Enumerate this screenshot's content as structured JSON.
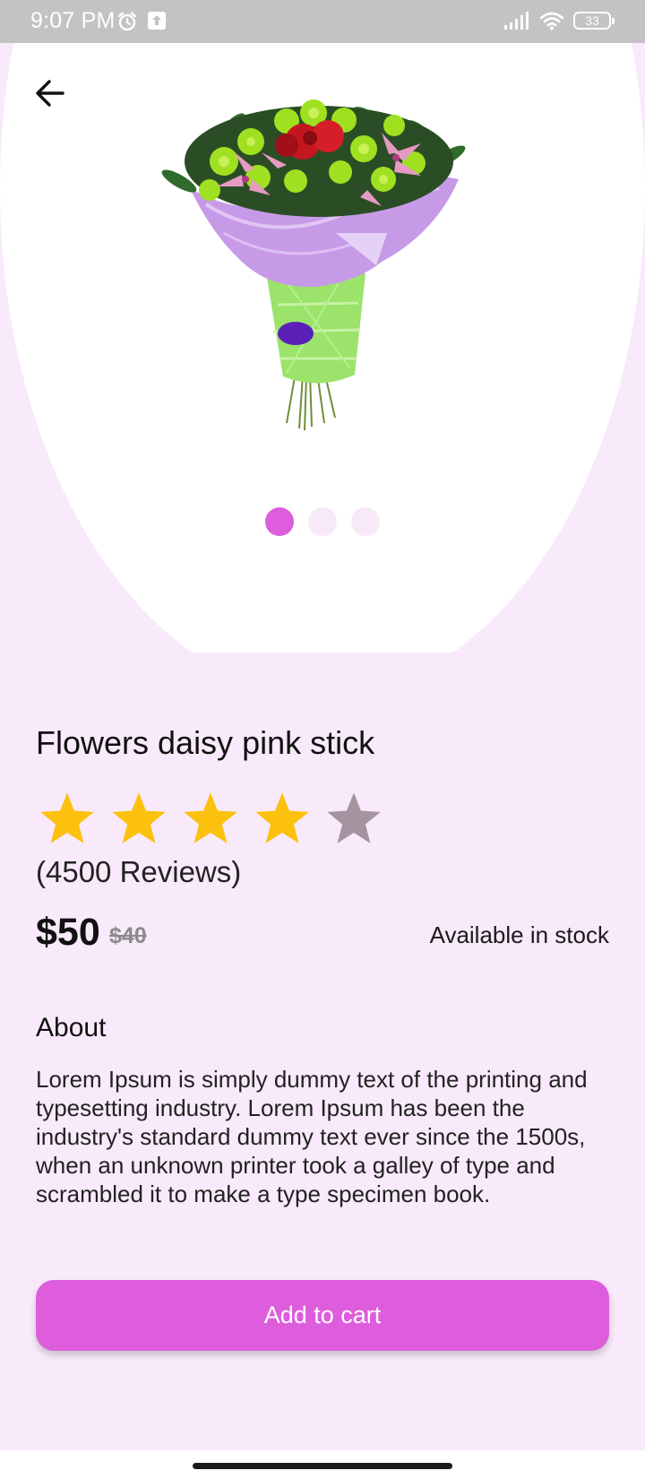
{
  "status_bar": {
    "time": "9:07 PM",
    "battery": "33",
    "icons": [
      "alarm-icon",
      "upload-icon",
      "signal-icon",
      "wifi-icon",
      "battery-icon"
    ]
  },
  "navigation": {
    "back_icon": "arrow-left-icon"
  },
  "carousel": {
    "image": "flower-bouquet",
    "page_count": 3,
    "active_page": 1
  },
  "product": {
    "title": "Flowers daisy pink stick",
    "rating": 4,
    "rating_max": 5,
    "reviews": "(4500 Reviews)",
    "price": "$50",
    "old_price": "$40",
    "availability": "Available in stock"
  },
  "about": {
    "heading": "About",
    "text": "Lorem Ipsum is simply dummy text of the printing and typesetting industry. Lorem Ipsum has been the industry's standard dummy text ever since the 1500s, when an unknown printer took a galley of type and scrambled it to make a type specimen book."
  },
  "actions": {
    "add_to_cart": "Add to cart"
  },
  "colors": {
    "accent": "#dd5ddd",
    "background": "#f8eafa",
    "star_filled": "#fcc10e",
    "star_empty": "#a4949f",
    "status_bar": "#c3c3c3"
  }
}
